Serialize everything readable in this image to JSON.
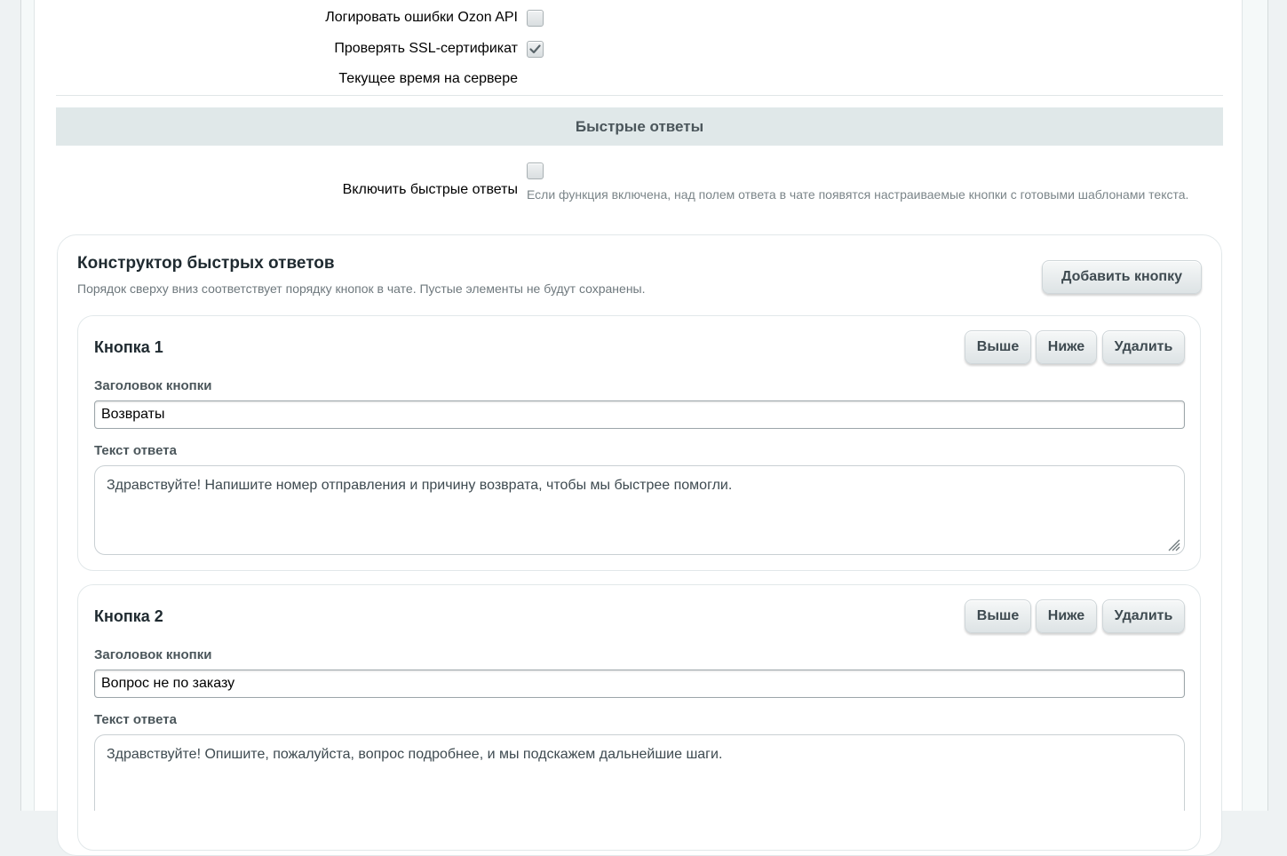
{
  "settings": {
    "log_errors_label": "Логировать ошибки Ozon API",
    "log_errors_checked": false,
    "verify_ssl_label": "Проверять SSL-сертификат",
    "verify_ssl_checked": true,
    "server_time_label": "Текущее время на сервере"
  },
  "quick_replies": {
    "section_title": "Быстрые ответы",
    "enable_label": "Включить быстрые ответы",
    "enable_checked": false,
    "enable_hint": "Если функция включена, над полем ответа в чате появятся настраиваемые кнопки с готовыми шаблонами текста."
  },
  "builder": {
    "title": "Конструктор быстрых ответов",
    "subtitle": "Порядок сверху вниз соответствует порядку кнопок в чате. Пустые элементы не будут сохранены.",
    "add_button_label": "Добавить кнопку",
    "up_label": "Выше",
    "down_label": "Ниже",
    "delete_label": "Удалить",
    "title_field_label": "Заголовок кнопки",
    "text_field_label": "Текст ответа",
    "items": [
      {
        "name": "Кнопка 1",
        "title_value": "Возвраты",
        "text_value": "Здравствуйте! Напишите номер отправления и причину возврата, чтобы мы быстрее помогли."
      },
      {
        "name": "Кнопка 2",
        "title_value": "Вопрос не по заказу",
        "text_value": "Здравствуйте! Опишите, пожалуйста, вопрос подробнее, и мы подскажем дальнейшие шаги."
      }
    ]
  }
}
